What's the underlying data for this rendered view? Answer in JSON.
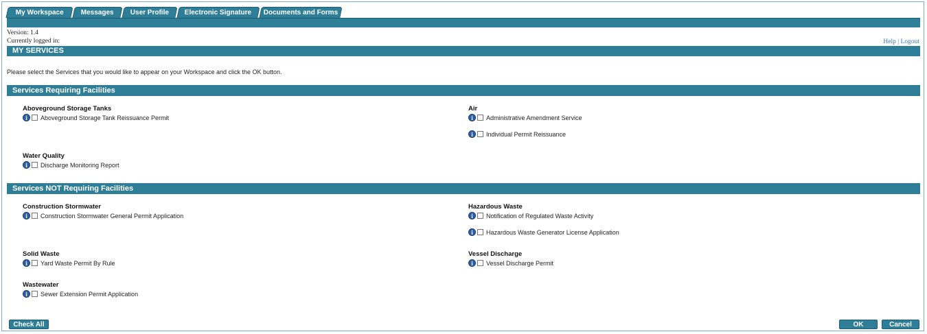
{
  "tabs": [
    "My Workspace",
    "Messages",
    "User Profile",
    "Electronic Signature",
    "Documents and Forms"
  ],
  "version_text": "Version: 1.4",
  "logged_in_text": "Currently logged in:",
  "links": {
    "help": "Help",
    "separator": "|",
    "logout": "Logout"
  },
  "page_title": "MY SERVICES",
  "instruction": "Please select the Services that you would like to appear on your Workspace and click the OK button.",
  "sections": {
    "requiring": {
      "title": "Services Requiring Facilities",
      "groups": {
        "aboveground": {
          "title": "Aboveground Storage Tanks",
          "services": [
            "Aboveground Storage Tank Reissuance Permit"
          ]
        },
        "air": {
          "title": "Air",
          "services": [
            "Administrative Amendment Service",
            "Individual Permit Reissuance"
          ]
        },
        "water": {
          "title": "Water Quality",
          "services": [
            "Discharge Monitoring Report"
          ]
        }
      }
    },
    "not_requiring": {
      "title": "Services NOT Requiring Facilities",
      "groups": {
        "construction": {
          "title": "Construction Stormwater",
          "services": [
            "Construction Stormwater General Permit Application"
          ]
        },
        "hazardous": {
          "title": "Hazardous Waste",
          "services": [
            "Notification of Regulated Waste Activity",
            "Hazardous Waste Generator License Application"
          ]
        },
        "solid": {
          "title": "Solid Waste",
          "services": [
            "Yard Waste Permit By Rule"
          ]
        },
        "vessel": {
          "title": "Vessel Discharge",
          "services": [
            "Vessel Discharge Permit"
          ]
        },
        "wastewater": {
          "title": "Wastewater",
          "services": [
            "Sewer Extension Permit Application"
          ]
        }
      }
    }
  },
  "buttons": {
    "check_all": "Check All",
    "ok": "OK",
    "cancel": "Cancel"
  },
  "info_glyph": "i",
  "colors": {
    "header_bg": "#2e7e98",
    "link": "#3a79b8"
  }
}
